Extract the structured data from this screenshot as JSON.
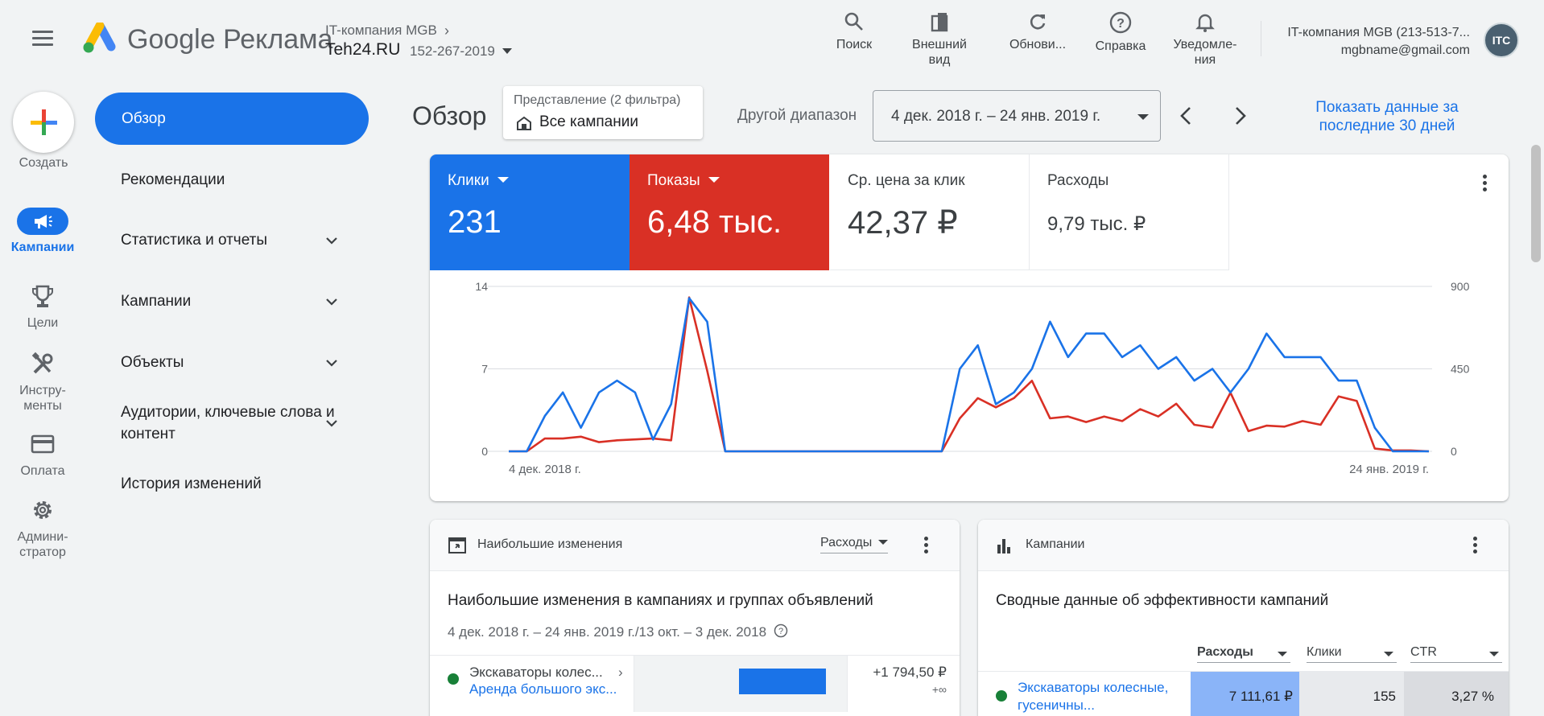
{
  "header": {
    "brand": "Google Реклама",
    "account_parent": "IT-компания MGB",
    "account_name": "Teh24.RU",
    "account_id": "152-267-2019",
    "tools": [
      {
        "icon": "search-icon",
        "label": "Поиск"
      },
      {
        "icon": "appearance-icon",
        "label": "Внешний вид"
      },
      {
        "icon": "refresh-icon",
        "label": "Обнови..."
      },
      {
        "icon": "help-icon",
        "label": "Справка"
      },
      {
        "icon": "bell-icon",
        "label": "Уведомле-ния"
      }
    ],
    "user_account": "IT-компания MGB (213-513-7...",
    "user_email": "mgbname@gmail.com"
  },
  "rail": {
    "create_label": "Создать",
    "items": [
      {
        "icon": "megaphone-icon",
        "label": "Кампании",
        "active": true
      },
      {
        "icon": "trophy-icon",
        "label": "Цели"
      },
      {
        "icon": "tools-icon",
        "label": "Инстру-менты"
      },
      {
        "icon": "card-icon",
        "label": "Оплата"
      },
      {
        "icon": "gear-icon",
        "label": "Админи-стратор"
      }
    ]
  },
  "nav": {
    "active": "Обзор",
    "items": [
      {
        "label": "Рекомендации"
      },
      {
        "label": "Статистика и отчеты"
      },
      {
        "label": "Кампании"
      },
      {
        "label": "Объекты"
      },
      {
        "label": "Аудитории, ключевые слова и контент"
      },
      {
        "label": "История изменений"
      }
    ]
  },
  "toolbar": {
    "title": "Обзор",
    "view_label": "Представление (2 фильтра)",
    "view_value": "Все кампании",
    "range_label": "Другой диапазон",
    "range_value": "4 дек. 2018 г. – 24 янв. 2019 г.",
    "show30": "Показать данные за последние 30 дней"
  },
  "metrics": [
    {
      "label": "Клики",
      "value": "231",
      "color": "#1a73e8"
    },
    {
      "label": "Показы",
      "value": "6,48 тыс.",
      "color": "#d93025"
    },
    {
      "label": "Ср. цена за клик",
      "value": "42,37 ₽"
    },
    {
      "label": "Расходы",
      "value": "9,79 тыс. ₽"
    }
  ],
  "chart_data": {
    "type": "line",
    "x_start_label": "4 дек. 2018 г.",
    "x_end_label": "24 янв. 2019 г.",
    "y_left_ticks": [
      "14",
      "7",
      "0"
    ],
    "y_right_ticks": [
      "900",
      "450",
      "0"
    ],
    "ylim_left": [
      0,
      14
    ],
    "ylim_right": [
      0,
      900
    ],
    "series": [
      {
        "name": "Клики",
        "axis": "left",
        "color": "#1a73e8",
        "values": [
          0,
          0,
          3,
          5,
          2,
          5,
          6,
          5,
          1,
          4,
          13,
          11,
          0,
          0,
          0,
          0,
          0,
          0,
          0,
          0,
          0,
          0,
          0,
          0,
          0,
          7,
          9,
          4,
          5,
          7,
          11,
          8,
          10,
          10,
          8,
          9,
          7,
          8,
          6,
          7,
          5,
          7,
          10,
          8,
          8,
          8,
          6,
          6,
          2,
          0,
          0,
          0
        ]
      },
      {
        "name": "Показы",
        "axis": "right",
        "color": "#d93025",
        "values": [
          0,
          0,
          70,
          70,
          80,
          50,
          60,
          65,
          70,
          60,
          840,
          440,
          0,
          0,
          0,
          0,
          0,
          0,
          0,
          0,
          0,
          0,
          0,
          0,
          0,
          180,
          290,
          240,
          290,
          385,
          180,
          190,
          160,
          190,
          165,
          230,
          190,
          260,
          145,
          130,
          320,
          110,
          140,
          135,
          165,
          145,
          300,
          275,
          15,
          5,
          5,
          0
        ]
      }
    ]
  },
  "changes_card": {
    "head": "Наибольшие изменения",
    "metric_select": "Расходы",
    "title": "Наибольшие изменения в кампаниях и группах объявлений",
    "period": "4 дек. 2018 г. – 24 янв. 2019 г./13 окт. – 3 дек. 2018",
    "row": {
      "campaign": "Экскаваторы колес...",
      "adgroup": "Аренда большого экс...",
      "delta": "+1 794,50 ₽",
      "delta_pct": "+∞",
      "bar_fraction": 1.0
    }
  },
  "campaigns_card": {
    "head": "Кампании",
    "title": "Сводные данные об эффективности кампаний",
    "columns": [
      "Расходы",
      "Клики",
      "CTR"
    ],
    "row": {
      "name": "Экскаваторы колесные, гусеничны...",
      "cost": "7 111,61 ₽",
      "clicks": "155",
      "ctr": "3,27 %"
    }
  }
}
